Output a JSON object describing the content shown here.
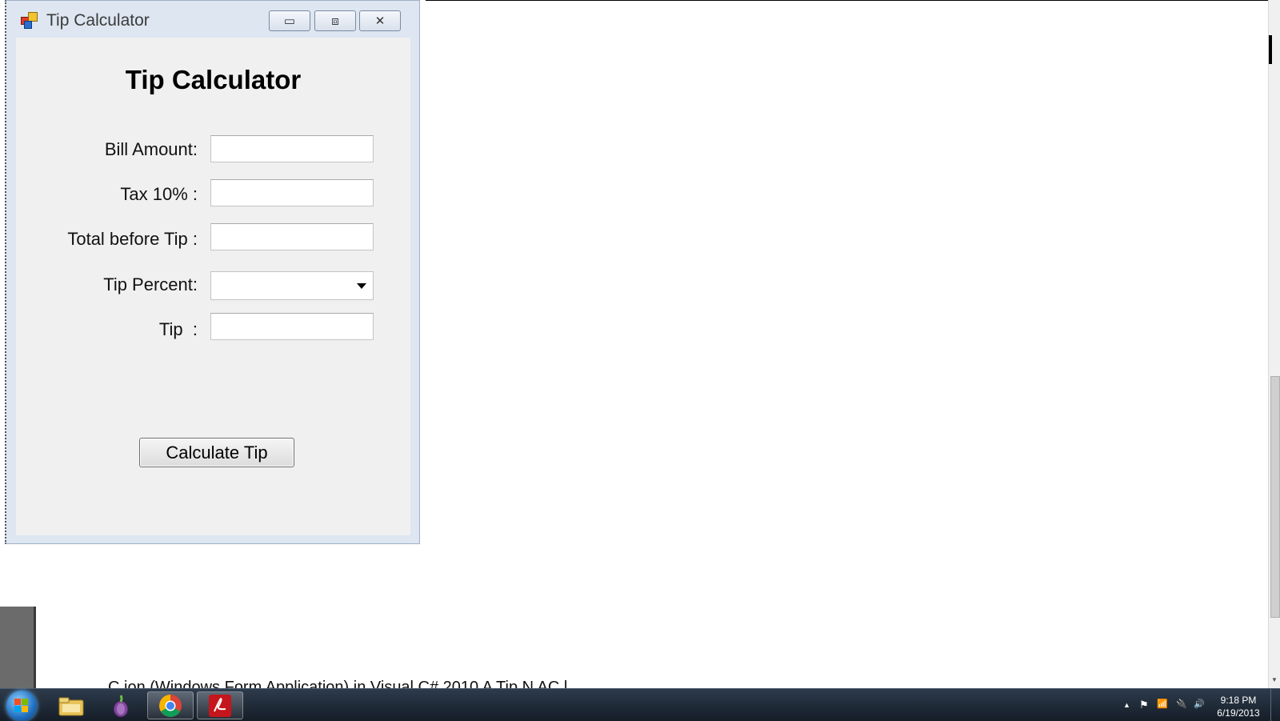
{
  "window": {
    "title": "Tip Calculator",
    "controls": {
      "minimize": "▭",
      "maximize": "⧈",
      "close": "✕"
    }
  },
  "form": {
    "heading": "Tip Calculator",
    "fields": {
      "bill_amount": {
        "label": "Bill Amount:",
        "value": ""
      },
      "tax": {
        "label": "Tax 10% :",
        "value": ""
      },
      "total_before_tip": {
        "label": "Total before Tip :",
        "value": ""
      },
      "tip_percent": {
        "label": "Tip Percent:",
        "selected": ""
      },
      "tip": {
        "label": "Tip  :",
        "value": ""
      }
    },
    "calculate_button": "Calculate Tip"
  },
  "background": {
    "cut_text": "C                        ion (Windows Form Application) in Visual C# 2010            A Tip                          N              AC   l"
  },
  "taskbar": {
    "apps": [
      "file-explorer",
      "tor-browser",
      "chrome",
      "acrobat"
    ],
    "tray": {
      "show_hidden": "▲",
      "action_center": "⚑",
      "network": "📶",
      "power": "🔌",
      "volume": "🔊"
    },
    "clock": {
      "time": "9:18 PM",
      "date": "6/19/2013"
    }
  },
  "colors": {
    "window_frame": "#dde6f1",
    "client": "#f0f0f0",
    "taskbar": "#1f2a36"
  }
}
